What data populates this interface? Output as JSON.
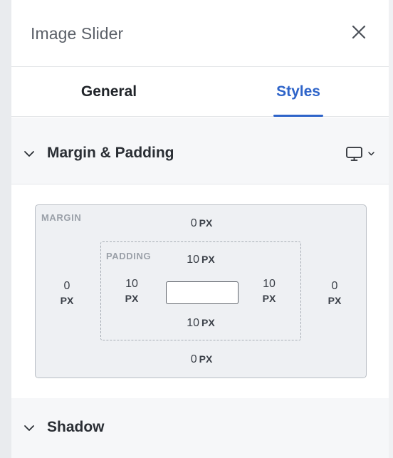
{
  "header": {
    "title": "Image Slider",
    "close_icon": "close-icon"
  },
  "tabs": [
    {
      "label": "General",
      "active": false
    },
    {
      "label": "Styles",
      "active": true
    }
  ],
  "colors": {
    "accent": "#2e64c9",
    "text": "#1f2328",
    "muted": "#9aa0a8"
  },
  "section_margin_padding": {
    "title": "Margin & Padding",
    "chevron_icon": "chevron-down-icon",
    "device_icon": "desktop-icon"
  },
  "box_model": {
    "margin": {
      "label": "MARGIN",
      "top": "0",
      "right": "0",
      "bottom": "0",
      "left": "0",
      "unit": "PX"
    },
    "padding": {
      "label": "PADDING",
      "top": "10",
      "right": "10",
      "bottom": "10",
      "left": "10",
      "unit": "PX"
    }
  },
  "section_shadow": {
    "title": "Shadow",
    "chevron_icon": "chevron-down-icon"
  }
}
